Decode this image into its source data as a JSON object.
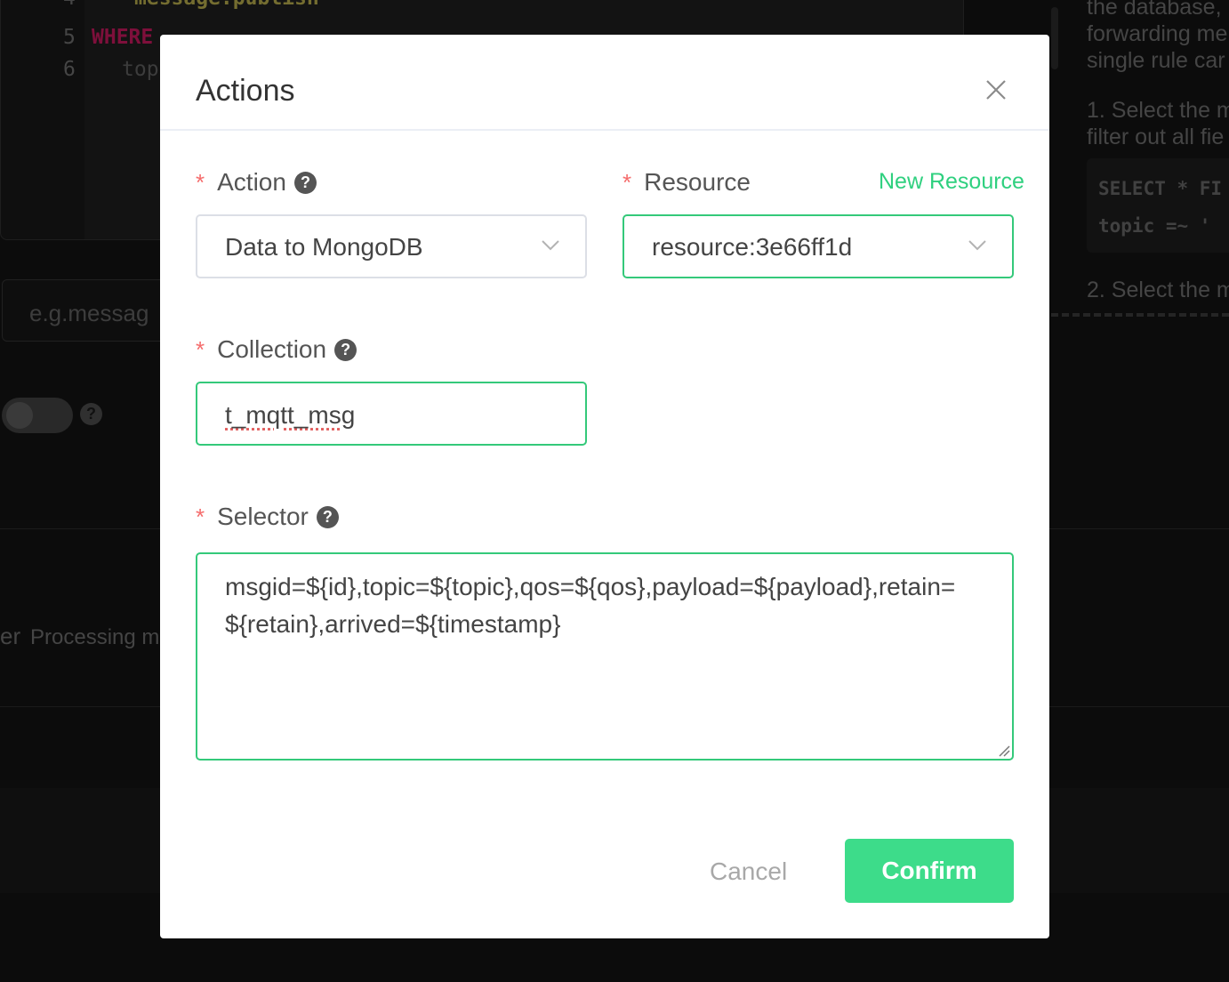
{
  "background": {
    "editor": {
      "lines": [
        {
          "num": "4",
          "text": "message.publish"
        },
        {
          "num": "5",
          "text": "WHERE"
        },
        {
          "num": "6",
          "text": "top"
        }
      ]
    },
    "sql_placeholder": "e.g.messag",
    "processing_fragment_prefix": "er",
    "processing_label": "Processing m",
    "help_glyph": "?",
    "right_panel": {
      "lines": [
        "the database,",
        "forwarding me",
        "single rule car",
        "1. Select the m",
        "filter out all fie",
        "2. Select the m"
      ],
      "code_lines": [
        "SELECT * FI",
        "topic =~ '"
      ]
    }
  },
  "dialog": {
    "title": "Actions",
    "action": {
      "label": "Action",
      "value": "Data to MongoDB"
    },
    "resource": {
      "label": "Resource",
      "value": "resource:3e66ff1d",
      "new_link": "New Resource"
    },
    "collection": {
      "label": "Collection",
      "value": "t_mqtt_msg"
    },
    "selector": {
      "label": "Selector",
      "value": "msgid=${id},topic=${topic},qos=${qos},payload=${payload},retain=${retain},arrived=${timestamp}"
    },
    "required_mark": "*",
    "help_glyph": "?",
    "cancel_label": "Cancel",
    "confirm_label": "Confirm"
  },
  "colors": {
    "accent": "#3ddc8a",
    "link": "#2fd07f",
    "required": "#f56c6c"
  },
  "icons": [
    "close-icon",
    "help-icon",
    "chevron-down-icon",
    "resize-handle-icon"
  ]
}
